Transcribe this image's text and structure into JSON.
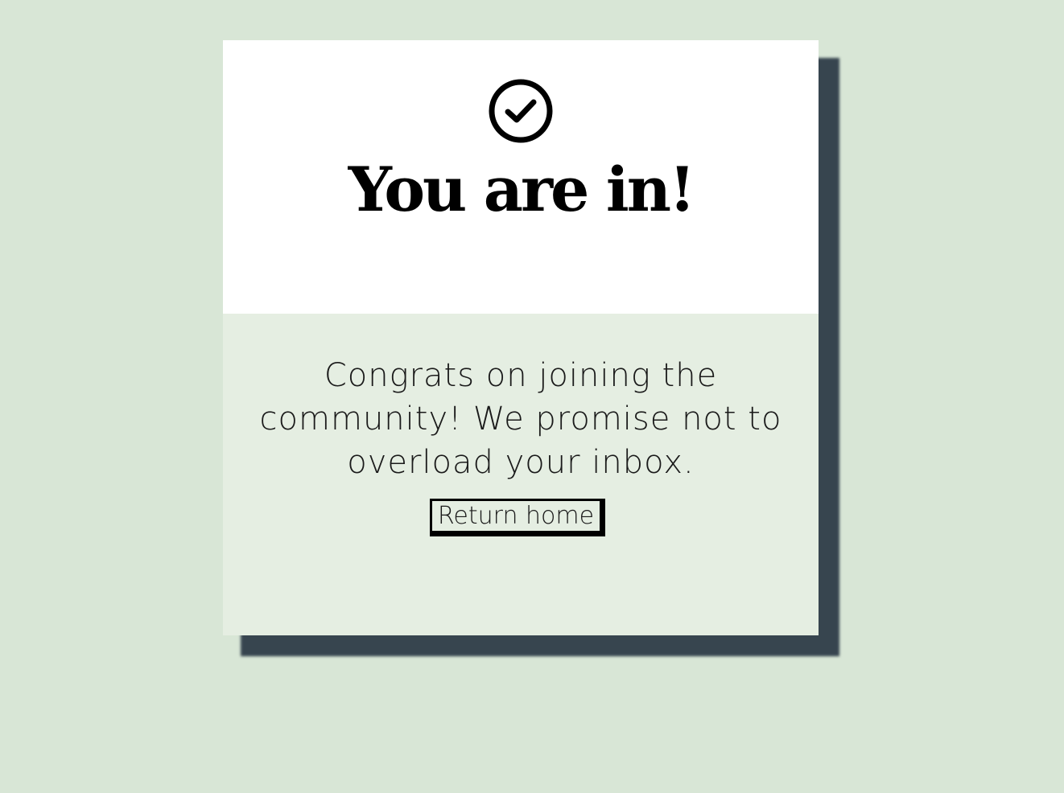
{
  "card": {
    "title": "You are in!",
    "message": "Congrats on joining the community! We promise not to overload your inbox.",
    "button_label": "Return home",
    "icon": "check-circle-icon"
  },
  "colors": {
    "page_background": "#d8e6d6",
    "card_top": "#ffffff",
    "card_bottom": "#e5eee2",
    "shadow": "#37454f",
    "text": "#000000"
  }
}
